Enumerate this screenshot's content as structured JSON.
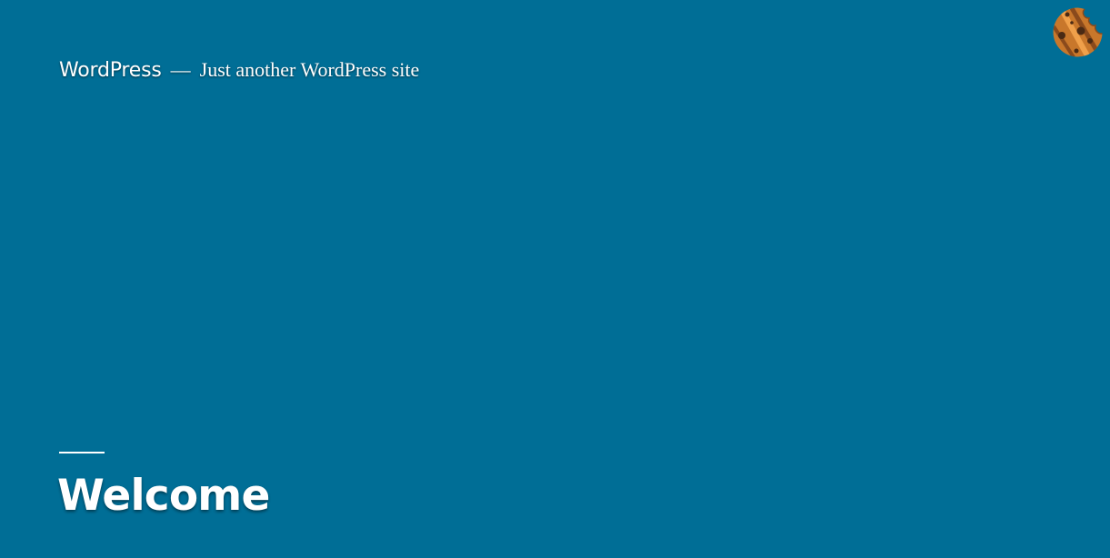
{
  "header": {
    "site_title": "WordPress",
    "separator": "—",
    "site_description": "Just another WordPress site"
  },
  "cookie_badge": {
    "icon": "cookie-icon",
    "colors": {
      "base": "#c8772b",
      "stripe": "#f0a04a",
      "chip": "#4a2a14"
    }
  },
  "page": {
    "title": "Welcome"
  },
  "colors": {
    "background": "#006e96",
    "text": "#ffffff"
  }
}
